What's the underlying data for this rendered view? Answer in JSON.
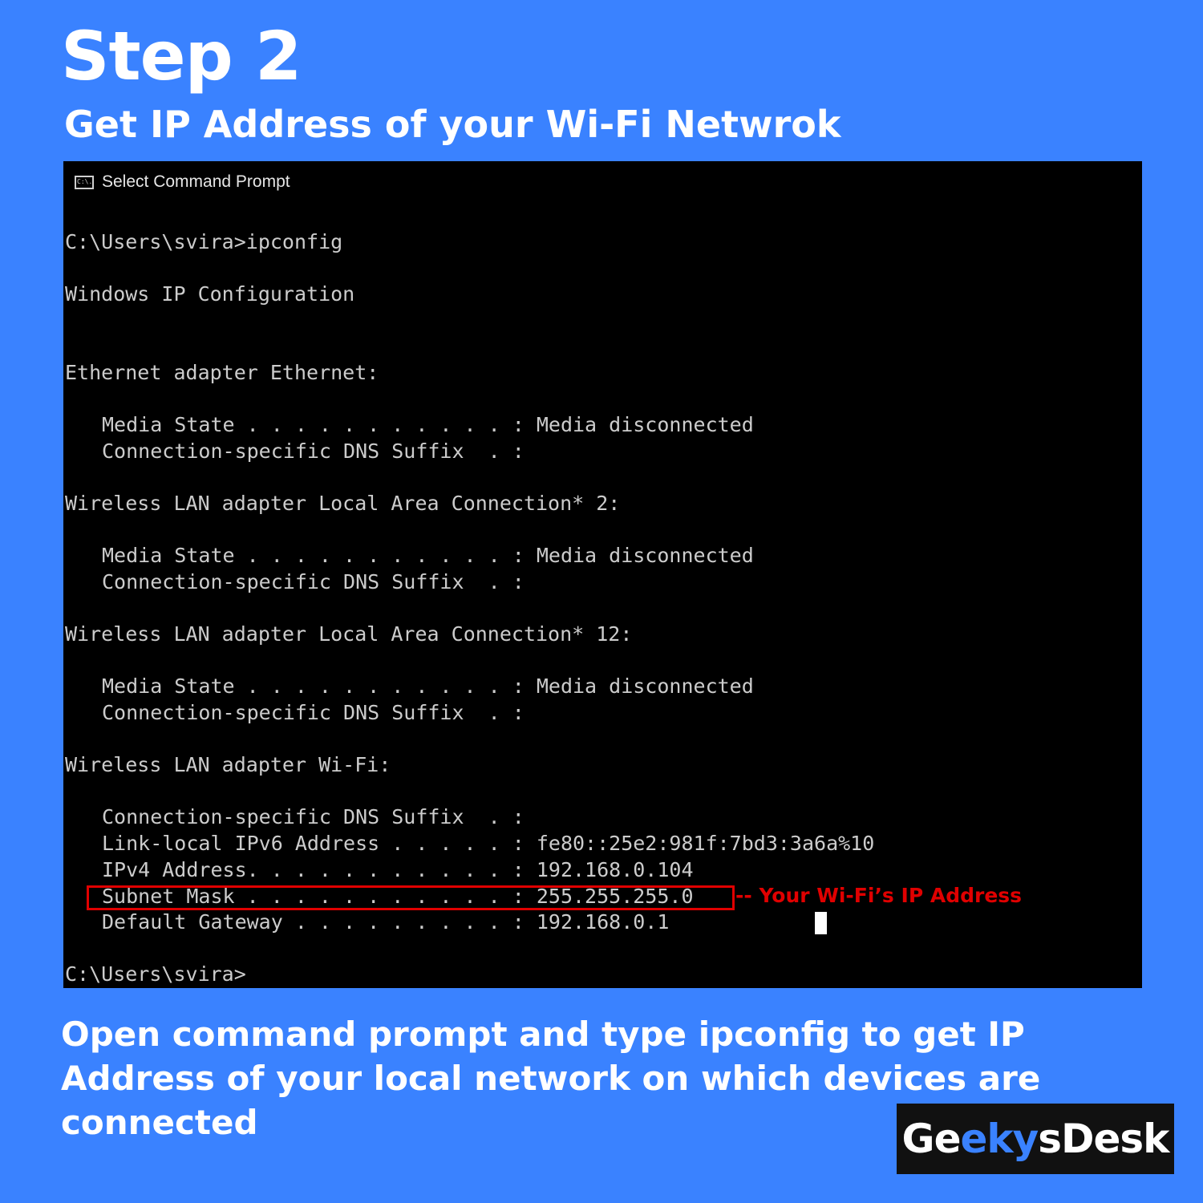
{
  "heading": {
    "title": "Step 2",
    "subtitle": "Get IP Address of your Wi-Fi Netwrok"
  },
  "window": {
    "title": "Select Command Prompt",
    "icon": "cmd-icon",
    "icon_text": "C:\\.",
    "lines": {
      "prompt": "C:\\Users\\svira>ipconfig",
      "header": "Windows IP Configuration",
      "eth_header": "Ethernet adapter Ethernet:",
      "eth_media": "Media State . . . . . . . . . . . : Media disconnected",
      "eth_dns": "Connection-specific DNS Suffix  . :",
      "lac2_header": "Wireless LAN adapter Local Area Connection* 2:",
      "lac2_media": "Media State . . . . . . . . . . . : Media disconnected",
      "lac2_dns": "Connection-specific DNS Suffix  . :",
      "lac12_header": "Wireless LAN adapter Local Area Connection* 12:",
      "lac12_media": "Media State . . . . . . . . . . . : Media disconnected",
      "lac12_dns": "Connection-specific DNS Suffix  . :",
      "wifi_header": "Wireless LAN adapter Wi-Fi:",
      "wifi_dns": "Connection-specific DNS Suffix  . :",
      "wifi_ipv6": "Link-local IPv6 Address . . . . . : fe80::25e2:981f:7bd3:3a6a%10",
      "wifi_ipv4": "IPv4 Address. . . . . . . . . . . : 192.168.0.104",
      "wifi_subnet": "Subnet Mask . . . . . . . . . . . : 255.255.255.0",
      "wifi_gateway": "Default Gateway . . . . . . . . . : 192.168.0.1",
      "end_prompt": "C:\\Users\\svira>"
    },
    "annotation": "-- Your Wi-Fi’s IP Address"
  },
  "description": "Open command prompt and type ipconfig to get IP Address of your local network on which devices are connected",
  "logo": {
    "part1": "Ge",
    "part2": "eky",
    "part3": "sDesk"
  },
  "colors": {
    "background": "#3a82ff",
    "terminal_bg": "#000000",
    "terminal_text": "#cccccc",
    "highlight": "#e00000",
    "logo_bg": "#111111"
  }
}
